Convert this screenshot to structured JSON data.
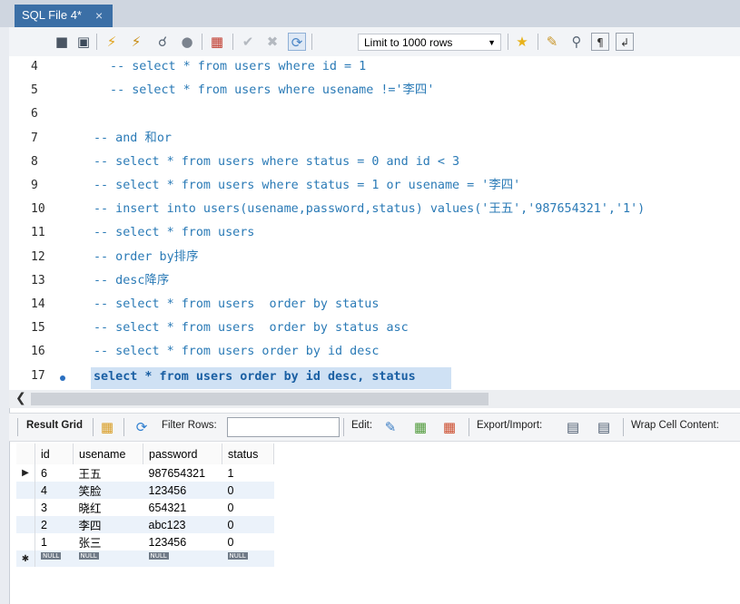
{
  "tab": {
    "title": "SQL File 4*",
    "close": "×"
  },
  "toolbar": {
    "limit_label": "Limit to 1000 rows",
    "icons": [
      "open-folder-icon",
      "save-icon",
      "execute-icon",
      "execute-selection-icon",
      "explain-icon",
      "stop-icon",
      "toggle-error-icon",
      "commit-icon",
      "rollback-icon",
      "autocommit-icon",
      "favorite-icon",
      "beautify-icon",
      "find-icon",
      "invisible-chars-icon",
      "wrap-icon"
    ]
  },
  "editor": {
    "lines": [
      {
        "num": "4",
        "text": " -- select * from users where id = 1"
      },
      {
        "num": "5",
        "text": " -- select * from users where usename !='李四'"
      },
      {
        "num": "6",
        "text": ""
      },
      {
        "num": "7",
        "text": "-- and 和or"
      },
      {
        "num": "8",
        "text": "-- select * from users where status = 0 and id < 3"
      },
      {
        "num": "9",
        "text": "-- select * from users where status = 1 or usename = '李四'"
      },
      {
        "num": "10",
        "text": "-- insert into users(usename,password,status) values('王五','987654321','1')"
      },
      {
        "num": "11",
        "text": "-- select * from users"
      },
      {
        "num": "12",
        "text": "-- order by排序"
      },
      {
        "num": "13",
        "text": "-- desc降序"
      },
      {
        "num": "14",
        "text": "-- select * from users  order by status"
      },
      {
        "num": "15",
        "text": "-- select * from users  order by status asc"
      },
      {
        "num": "16",
        "text": "-- select * from users order by id desc"
      },
      {
        "num": "17",
        "text": "select * from users order by id desc, status"
      }
    ]
  },
  "result_toolbar": {
    "result_grid": "Result Grid",
    "filter_rows": "Filter Rows:",
    "edit": "Edit:",
    "export_import": "Export/Import:",
    "wrap_cell": "Wrap Cell Content:"
  },
  "grid": {
    "columns": [
      "id",
      "usename",
      "password",
      "status"
    ],
    "rows": [
      [
        "6",
        "王五",
        "987654321",
        "1"
      ],
      [
        "4",
        "笑脸",
        "123456",
        "0"
      ],
      [
        "3",
        "晓红",
        "654321",
        "0"
      ],
      [
        "2",
        "李四",
        "abc123",
        "0"
      ],
      [
        "1",
        "张三",
        "123456",
        "0"
      ]
    ],
    "null_label": "NULL"
  }
}
